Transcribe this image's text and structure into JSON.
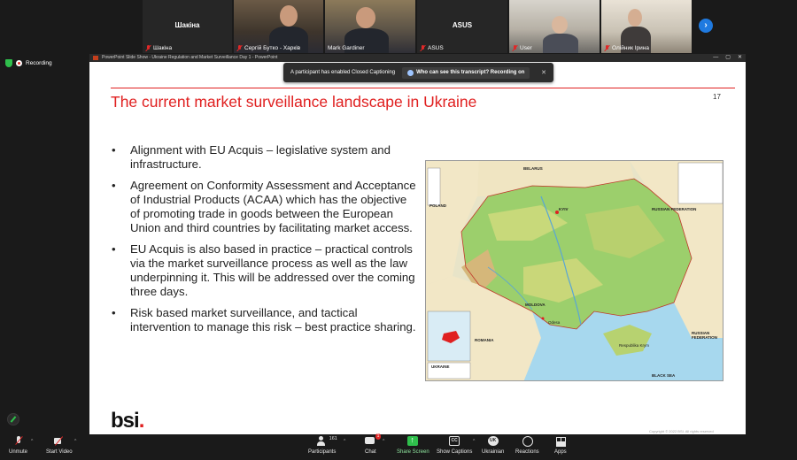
{
  "gallery": {
    "tiles": [
      {
        "name": "Шакіна",
        "display": "Шакіна"
      },
      {
        "name": "Сергій Бутко - Харків"
      },
      {
        "name": "Mark Gardiner"
      },
      {
        "name": "ASUS",
        "display": "ASUS"
      },
      {
        "name": "User"
      },
      {
        "name": "Олійник Ірина"
      }
    ]
  },
  "recording": {
    "label": "Recording"
  },
  "window": {
    "title": "PowerPoint Slide Show - Ukraine Regulation and Market Surveillance Day 1 - PowerPoint",
    "controls": [
      "—",
      "▢",
      "✕"
    ]
  },
  "captions_banner": {
    "message": "A participant has enabled Closed Captioning",
    "button": "Who can see this transcript? Recording on",
    "close": "✕"
  },
  "slide": {
    "title": "The current market surveillance landscape in Ukraine",
    "number": "17",
    "bullets": [
      "Alignment with EU Acquis – legislative system and infrastructure.",
      "Agreement on Conformity Assessment and Acceptance of Industrial Products (ACAA) which has the objective of promoting trade in goods between the European Union and third countries by facilitating market access.",
      "EU Acquis is also based in practice – practical controls via the market surveillance process as well as the law underpinning it. This will be addressed over the coming three days.",
      "Risk based market surveillance, and tactical intervention to manage this risk – best practice sharing."
    ],
    "logo": {
      "text": "bsi",
      "dot": "."
    },
    "copyright": "Copyright © 2022 BSI. All rights reserved"
  },
  "map": {
    "labels": {
      "belarus": "BELARUS",
      "poland": "POLAND",
      "russia": "RUSSIAN FEDERATION",
      "kyiv": "KYIV",
      "moldova": "MOLDOVA",
      "romania": "ROMANIA",
      "black_sea": "BLACK SEA",
      "ukraine": "UKRAINE",
      "crimea": "Respublika Krym",
      "odesa": "Odesa",
      "russia_east": "RUSSIAN FEDERATION"
    }
  },
  "toolbar": {
    "unmute": "Unmute",
    "start_video": "Start Video",
    "participants": "Participants",
    "participants_count": "161",
    "chat": "Chat",
    "chat_badge": "1",
    "share_screen": "Share Screen",
    "show_captions": "Show Captions",
    "cc_icon": "CC",
    "language": "Ukrainian",
    "language_icon": "UK",
    "reactions": "Reactions",
    "apps": "Apps"
  },
  "colors": {
    "accent_red": "#e02020",
    "share_green": "#2fbf4c",
    "zoom_blue": "#1f7ae0"
  }
}
